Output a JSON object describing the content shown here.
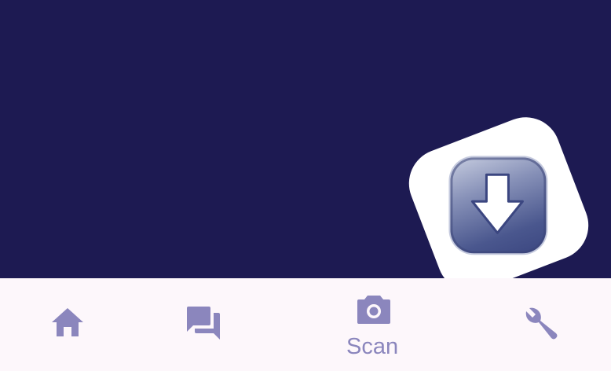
{
  "colors": {
    "background": "#1d1a52",
    "nav_background": "#fdf7fb",
    "nav_icon": "#8b86bd",
    "card": "#ffffff"
  },
  "app_card": {
    "icon": "download-arrow-icon"
  },
  "bottom_nav": {
    "items": [
      {
        "icon": "home-icon",
        "label": ""
      },
      {
        "icon": "forum-icon",
        "label": ""
      },
      {
        "icon": "camera-icon",
        "label": "Scan",
        "selected": true
      },
      {
        "icon": "wrench-icon",
        "label": ""
      }
    ]
  }
}
